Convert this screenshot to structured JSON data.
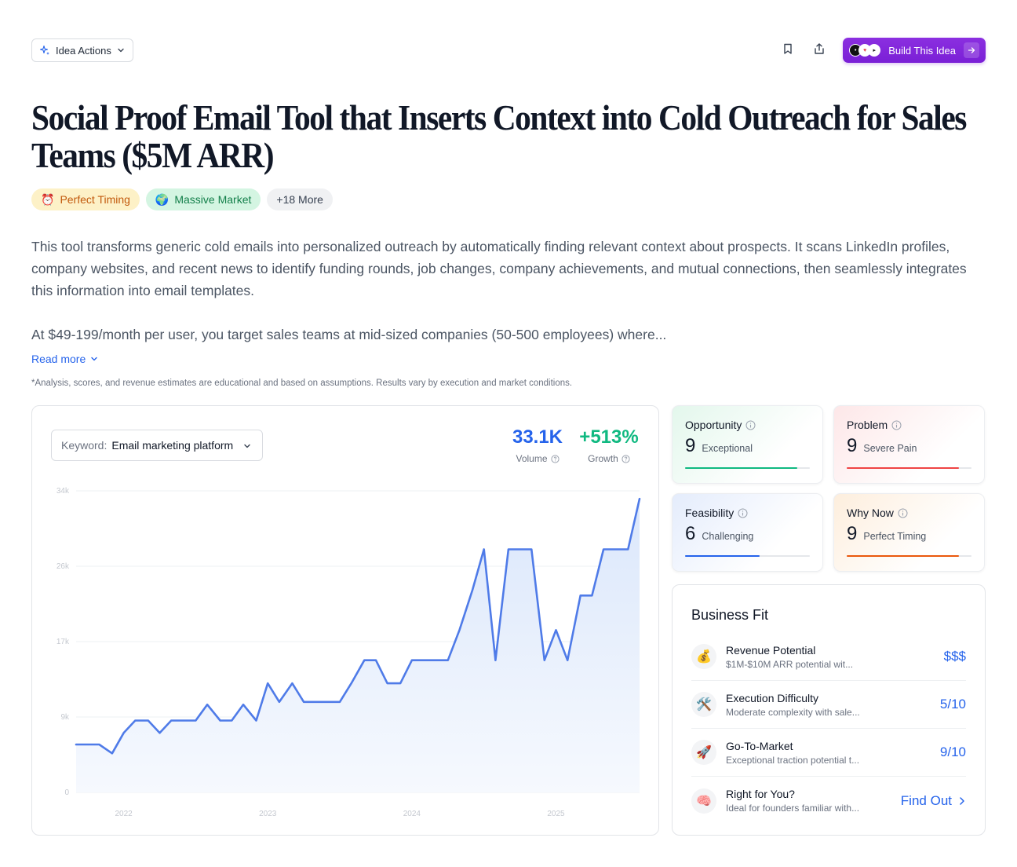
{
  "topbar": {
    "idea_actions_label": "Idea Actions",
    "build_label": "Build This Idea"
  },
  "title": "Social Proof Email Tool that Inserts Context into Cold Outreach for Sales Teams ($5M ARR)",
  "badges": [
    {
      "emoji": "⏰",
      "label": "Perfect Timing"
    },
    {
      "emoji": "🌍",
      "label": "Massive Market"
    },
    {
      "label": "+18 More"
    }
  ],
  "description": {
    "p1": "This tool transforms generic cold emails into personalized outreach by automatically finding relevant context about prospects. It scans LinkedIn profiles, company websites, and recent news to identify funding rounds, job changes, company achievements, and mutual connections, then seamlessly integrates this information into email templates.",
    "p2": "At $49-199/month per user, you target sales teams at mid-sized companies (50-500 employees) where...",
    "read_more": "Read more"
  },
  "disclaimer": "*Analysis, scores, and revenue estimates are educational and based on assumptions. Results vary by execution and market conditions.",
  "trend": {
    "keyword_label": "Keyword:",
    "keyword_value": "Email marketing platform",
    "volume_value": "33.1K",
    "volume_label": "Volume",
    "growth_value": "+513%",
    "growth_label": "Growth"
  },
  "chart_data": {
    "type": "area",
    "title": "",
    "xlabel": "",
    "ylabel": "",
    "ylim": [
      0,
      34000
    ],
    "y_ticks": [
      "0",
      "9k",
      "17k",
      "26k",
      "34k"
    ],
    "y_tick_values": [
      0,
      8500,
      17000,
      25500,
      34000
    ],
    "x_ticks": [
      "2022",
      "2023",
      "2024",
      "2025"
    ],
    "x_tick_values": [
      2022.0,
      2023.0,
      2024.0,
      2025.0
    ],
    "x": [
      2021.67,
      2021.75,
      2021.83,
      2021.92,
      2022.0,
      2022.08,
      2022.17,
      2022.25,
      2022.33,
      2022.42,
      2022.5,
      2022.58,
      2022.67,
      2022.75,
      2022.83,
      2022.92,
      2023.0,
      2023.08,
      2023.17,
      2023.25,
      2023.33,
      2023.42,
      2023.5,
      2023.58,
      2023.67,
      2023.75,
      2023.83,
      2023.92,
      2024.0,
      2024.08,
      2024.17,
      2024.25,
      2024.33,
      2024.42,
      2024.5,
      2024.58,
      2024.67,
      2024.75,
      2024.83,
      2024.92,
      2025.0,
      2025.08,
      2025.17,
      2025.25,
      2025.33,
      2025.42,
      2025.5,
      2025.58
    ],
    "series": [
      {
        "values": [
          5400,
          5400,
          5400,
          4400,
          6700,
          8100,
          8100,
          6700,
          8100,
          8100,
          8100,
          9900,
          8100,
          8100,
          9900,
          8100,
          12300,
          10200,
          12300,
          10200,
          10200,
          10200,
          10200,
          12300,
          14900,
          14900,
          12300,
          12300,
          14900,
          14900,
          14900,
          14900,
          18300,
          22800,
          27400,
          14900,
          27400,
          27400,
          27400,
          14900,
          18300,
          14900,
          22200,
          22200,
          27400,
          27400,
          27400,
          33100
        ]
      }
    ]
  },
  "scores": {
    "opportunity": {
      "name": "Opportunity",
      "score": "9",
      "desc": "Exceptional",
      "value": 0.9,
      "color": "#10b981"
    },
    "problem": {
      "name": "Problem",
      "score": "9",
      "desc": "Severe Pain",
      "value": 0.9,
      "color": "#ef4444"
    },
    "feasibility": {
      "name": "Feasibility",
      "score": "6",
      "desc": "Challenging",
      "value": 0.6,
      "color": "#2563eb"
    },
    "why_now": {
      "name": "Why Now",
      "score": "9",
      "desc": "Perfect Timing",
      "value": 0.9,
      "color": "#ea580c"
    }
  },
  "business_fit": {
    "title": "Business Fit",
    "rows": [
      {
        "emoji": "💰",
        "title": "Revenue Potential",
        "sub": "$1M-$10M ARR potential wit...",
        "value": "$$$"
      },
      {
        "emoji": "🛠️",
        "title": "Execution Difficulty",
        "sub": "Moderate complexity with sale...",
        "value": "5/10"
      },
      {
        "emoji": "🚀",
        "title": "Go-To-Market",
        "sub": "Exceptional traction potential t...",
        "value": "9/10"
      },
      {
        "emoji": "🧠",
        "title": "Right for You?",
        "sub": "Ideal for founders familiar with...",
        "value": "Find Out"
      }
    ]
  },
  "colors": {
    "accent": "#2563eb",
    "growth": "#10b981",
    "build_button": "#7a1fd6",
    "line": "#4f7be8",
    "area": "#dbe7fb"
  }
}
